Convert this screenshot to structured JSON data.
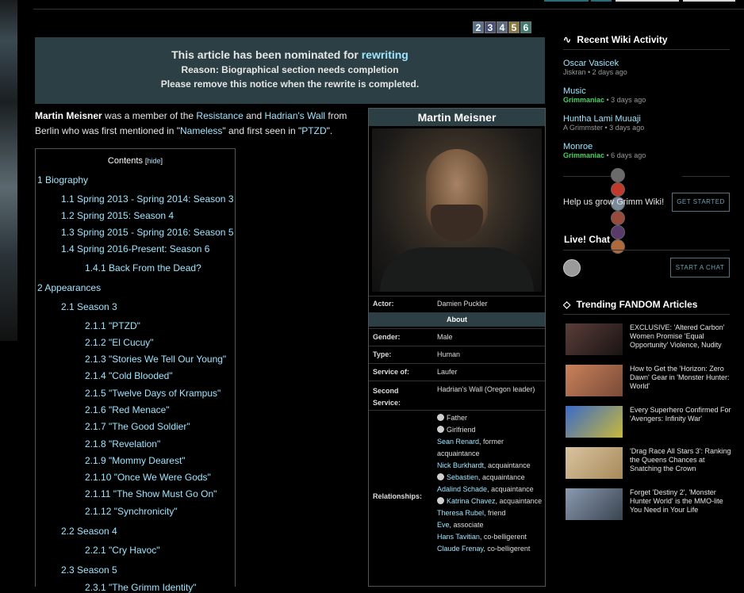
{
  "page": {
    "top_tabs": [
      {
        "color": "#2b6a78"
      },
      {
        "color": "#d6d6d6"
      },
      {
        "color": "#d6d6d6"
      }
    ]
  },
  "pager": [
    "2",
    "3",
    "4",
    "5",
    "6"
  ],
  "pager_colors": [
    "#59718c",
    "#49517a",
    "#5b6b82",
    "#8c7a43",
    "#3f7a73"
  ],
  "notice": {
    "line1_prefix": "This article has been nominated for",
    "line1_link": "rewriting",
    "line2": "Reason: Biographical section needs completion",
    "line3": "Please remove this notice when the rewrite is completed."
  },
  "intro": {
    "name": "Martin Meisner",
    "t1": " was a member of the ",
    "l1": "Resistance",
    "t2": " and ",
    "l2": "Hadrian's Wall",
    "t3": " from Berlin who was first mentioned in \"",
    "l3": "Nameless",
    "t4": "\" and first seen in \"",
    "l4": "PTZD",
    "t5": "\"."
  },
  "toc": {
    "title": "Contents",
    "hide_open": "[",
    "hide_label": "hide",
    "hide_close": "]",
    "items": [
      "1 Biography",
      "1.1 Spring 2013 - Spring 2014: Season 3",
      "1.2 Spring 2015: Season 4",
      "1.3 Spring 2015 - Spring 2016: Season 5",
      "1.4 Spring 2016-Present: Season 6",
      "1.4.1 Back From the Dead?",
      "2 Appearances",
      "2.1 Season 3",
      "2.1.1 \"PTZD\"",
      "2.1.2 \"El Cucuy\"",
      "2.1.3 \"Stories We Tell Our Young\"",
      "2.1.4 \"Cold Blooded\"",
      "2.1.5 \"Twelve Days of Krampus\"",
      "2.1.6 \"Red Menace\"",
      "2.1.7 \"The Good Soldier\"",
      "2.1.8 \"Revelation\"",
      "2.1.9 \"Mommy Dearest\"",
      "2.1.10 \"Once We Were Gods\"",
      "2.1.11 \"The Show Must Go On\"",
      "2.1.12 \"Synchronicity\"",
      "2.2 Season 4",
      "2.2.1 \"Cry Havoc\"",
      "2.3 Season 5",
      "2.3.1 \"The Grimm Identity\""
    ]
  },
  "infobox": {
    "title": "Martin Meisner",
    "actor_label": "Actor:",
    "actor_value": "Damien Puckler",
    "about": "About",
    "gender_label": "Gender:",
    "gender_value": "Male",
    "type_label": "Type:",
    "type_value": "Human",
    "service_label": "Service of:",
    "service_value": "Laufer",
    "second_label_1": "Second",
    "second_label_2": "Service:",
    "second_value": "Hadrian's Wall (Oregon leader)",
    "rel_label": "Relationships:",
    "relationships": [
      {
        "skull": true,
        "name": "Father",
        "link": false,
        "note": ""
      },
      {
        "skull": true,
        "name": "Girlfriend",
        "link": false,
        "note": ""
      },
      {
        "skull": false,
        "name": "Sean Renard",
        "link": true,
        "note": ", former acquaintance"
      },
      {
        "skull": false,
        "name": "Nick Burkhardt",
        "link": true,
        "note": ", acquaintance"
      },
      {
        "skull": true,
        "name": "Sebastien",
        "link": true,
        "note": ", acquaintance"
      },
      {
        "skull": false,
        "name": "Adalind Schade",
        "link": true,
        "note": ", acquaintance"
      },
      {
        "skull": true,
        "name": "Katrina Chavez",
        "link": true,
        "note": ", acquaintance"
      },
      {
        "skull": false,
        "name": "Theresa Rubel",
        "link": true,
        "note": ", friend"
      },
      {
        "skull": false,
        "name": "Eve",
        "link": true,
        "note": ", associate"
      },
      {
        "skull": false,
        "name": "Hans Tavitian",
        "link": true,
        "note": ", co-belligerent"
      },
      {
        "skull": false,
        "name": "Claude Frenay",
        "link": true,
        "note": ", co-belligerent"
      }
    ]
  },
  "recent": {
    "title": "Recent Wiki Activity",
    "items": [
      {
        "title": "Oscar Vasicek",
        "user": "Jiskran",
        "green": false,
        "time": " • 2 days ago"
      },
      {
        "title": "Music",
        "user": "Grimmaniac",
        "green": true,
        "time": " • 3 days ago"
      },
      {
        "title": "Huntha Lami Muuaji",
        "user": "A Grimmster",
        "green": false,
        "time": " • 3 days ago"
      },
      {
        "title": "Monroe",
        "user": "Grimmaniac",
        "green": true,
        "time": " • 6 days ago"
      }
    ],
    "avatar_colors": [
      "#6a6a6a",
      "#c0392b",
      "#7a8a9a",
      "#9a4a3a",
      "#5a3a6a",
      "#b06a3a"
    ],
    "grow_text": "Help us grow Grimm Wiki!",
    "get_started": "GET STARTED"
  },
  "chat": {
    "title": "Live! Chat",
    "start": "START A CHAT"
  },
  "trending": {
    "title": "Trending FANDOM Articles",
    "items": [
      {
        "text": "EXCLUSIVE: 'Altered Carbon' Women Promise 'Equal Opportunity' Violence, Nudity",
        "c1": "#5a3d38",
        "c2": "#1a1414"
      },
      {
        "text": "How to Get the 'Horizon: Zero Dawn' Gear in 'Monster Hunter: World'",
        "c1": "#c9825a",
        "c2": "#7a4a38"
      },
      {
        "text": "Every Superhero Confirmed For 'Avengers: Infinity War'",
        "c1": "#3a6ac8",
        "c2": "#c8b83a"
      },
      {
        "text": "'Drag Race All Stars 3': Ranking the Queens Chances at Snatching the Crown",
        "c1": "#d8c3a0",
        "c2": "#a88a5a"
      },
      {
        "text": "Forget 'Destiny 2', 'Monster Hunter World' is the MMO-lite You Need in Your Life",
        "c1": "#8a9ab0",
        "c2": "#3a4450"
      }
    ]
  }
}
